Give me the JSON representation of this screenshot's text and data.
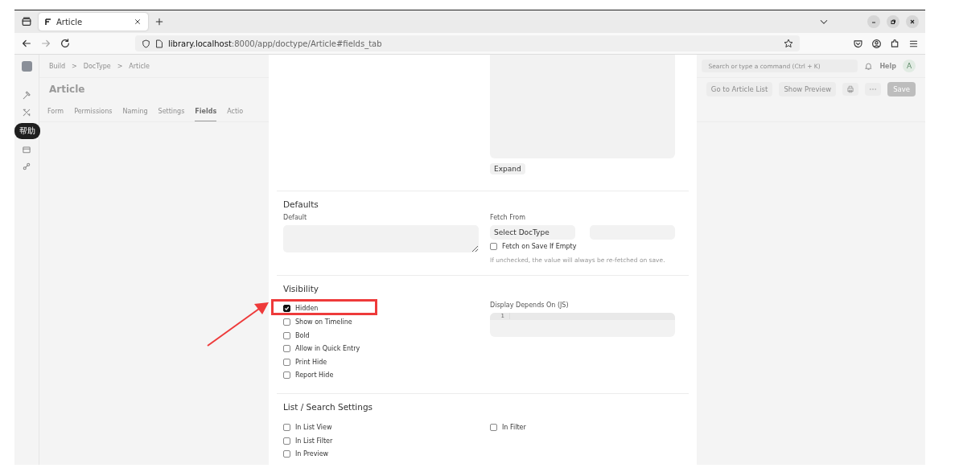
{
  "browser": {
    "tab": {
      "title": "Article"
    },
    "address": {
      "host": "library.localhost",
      "path": ":8000/app/doctype/Article#fields_tab"
    }
  },
  "tooltip": {
    "text": "帮助"
  },
  "page": {
    "breadcrumbs": [
      "Build",
      "DocType",
      "Article"
    ],
    "separator": ">",
    "title": "Article",
    "tabs": [
      {
        "label": "Form",
        "selected": false
      },
      {
        "label": "Permissions",
        "selected": false
      },
      {
        "label": "Naming",
        "selected": false
      },
      {
        "label": "Settings",
        "selected": false
      },
      {
        "label": "Fields",
        "selected": true
      },
      {
        "label": "Actio",
        "selected": false
      }
    ],
    "search": {
      "placeholder": "Search or type a command (Ctrl + K)"
    },
    "help": "Help",
    "avatar": "A",
    "actions": [
      "Go to Article List",
      "Show Preview"
    ],
    "save": "Save"
  },
  "dialog": {
    "expand": "Expand",
    "sections": [
      {
        "title": "Defaults",
        "left": [
          {
            "kind": "textarea",
            "label": "Default"
          }
        ],
        "right": [
          {
            "kind": "link",
            "label": "Fetch From",
            "placeholder": "Select DocType"
          },
          {
            "kind": "checkbox",
            "label": "Fetch on Save If Empty",
            "checked": false
          },
          {
            "kind": "help",
            "text": "If unchecked, the value will always be re-fetched on save."
          }
        ]
      },
      {
        "title": "Visibility",
        "left": [
          {
            "kind": "checkbox",
            "label": "Hidden",
            "checked": true
          },
          {
            "kind": "checkbox",
            "label": "Show on Timeline",
            "checked": false
          },
          {
            "kind": "checkbox",
            "label": "Bold",
            "checked": false
          },
          {
            "kind": "checkbox",
            "label": "Allow in Quick Entry",
            "checked": false
          },
          {
            "kind": "checkbox",
            "label": "Print Hide",
            "checked": false
          },
          {
            "kind": "checkbox",
            "label": "Report Hide",
            "checked": false
          }
        ],
        "right": [
          {
            "kind": "code",
            "label": "Display Depends On (JS)",
            "line": "1"
          }
        ]
      },
      {
        "title": "List / Search Settings",
        "left": [
          {
            "kind": "checkbox",
            "label": "In List View",
            "checked": false
          },
          {
            "kind": "checkbox",
            "label": "In List Filter",
            "checked": false
          },
          {
            "kind": "checkbox",
            "label": "In Preview",
            "checked": false
          }
        ],
        "right": [
          {
            "kind": "checkbox",
            "label": "In Filter",
            "checked": false
          }
        ]
      }
    ]
  }
}
